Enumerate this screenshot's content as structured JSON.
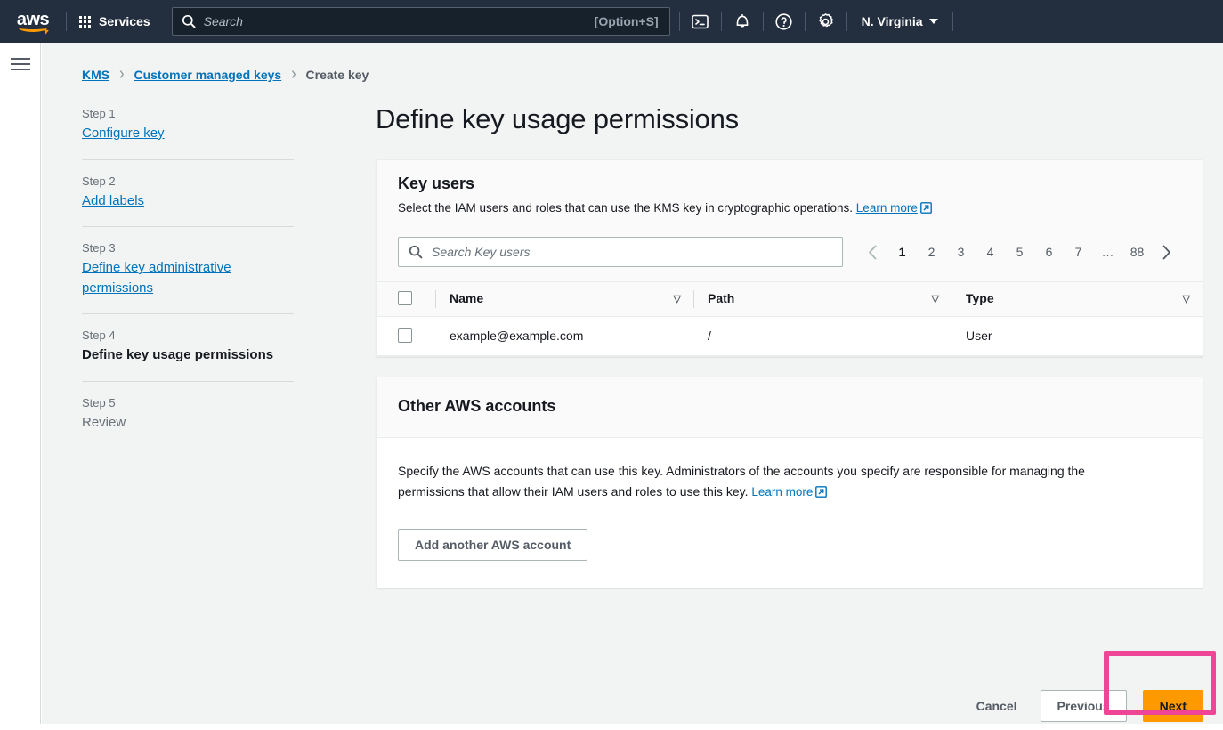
{
  "topnav": {
    "logo_text": "aws",
    "services_label": "Services",
    "search_placeholder": "Search",
    "search_hint": "[Option+S]",
    "icons": [
      "cloudshell-icon",
      "bell-icon",
      "help-icon",
      "settings-icon"
    ],
    "region_label": "N. Virginia"
  },
  "breadcrumb": {
    "items": [
      {
        "label": "KMS",
        "link": true
      },
      {
        "label": "Customer managed keys",
        "link": true
      },
      {
        "label": "Create key",
        "link": false
      }
    ],
    "separator": "›"
  },
  "steps": [
    {
      "num": "Step 1",
      "label": "Configure key",
      "state": "link"
    },
    {
      "num": "Step 2",
      "label": "Add labels",
      "state": "link"
    },
    {
      "num": "Step 3",
      "label": "Define key administrative permissions",
      "state": "link"
    },
    {
      "num": "Step 4",
      "label": "Define key usage permissions",
      "state": "active"
    },
    {
      "num": "Step 5",
      "label": "Review",
      "state": "plain"
    }
  ],
  "main": {
    "page_title": "Define key usage permissions",
    "key_users": {
      "title": "Key users",
      "description": "Select the IAM users and roles that can use the KMS key in cryptographic operations.",
      "learn_more": "Learn more",
      "search_placeholder": "Search Key users",
      "pagination": {
        "prev": "‹",
        "pages": [
          "1",
          "2",
          "3",
          "4",
          "5",
          "6",
          "7",
          "…",
          "88"
        ],
        "current": "1",
        "next": "›"
      },
      "columns": [
        "Name",
        "Path",
        "Type"
      ],
      "rows": [
        {
          "name": "example@example.com",
          "path": "/",
          "type": "User",
          "checked": false
        }
      ]
    },
    "other_accounts": {
      "title": "Other AWS accounts",
      "description": "Specify the AWS accounts that can use this key. Administrators of the accounts you specify are responsible for managing the permissions that allow their IAM users and roles to use this key.",
      "learn_more": "Learn more",
      "add_button": "Add another AWS account"
    }
  },
  "footer": {
    "cancel": "Cancel",
    "previous": "Previous",
    "next": "Next"
  },
  "colors": {
    "nav_background": "#232f3e",
    "accent_orange": "#ff9900",
    "link_blue": "#0073bb",
    "page_background": "#f2f3f3",
    "highlight_pink": "#ef4597"
  }
}
